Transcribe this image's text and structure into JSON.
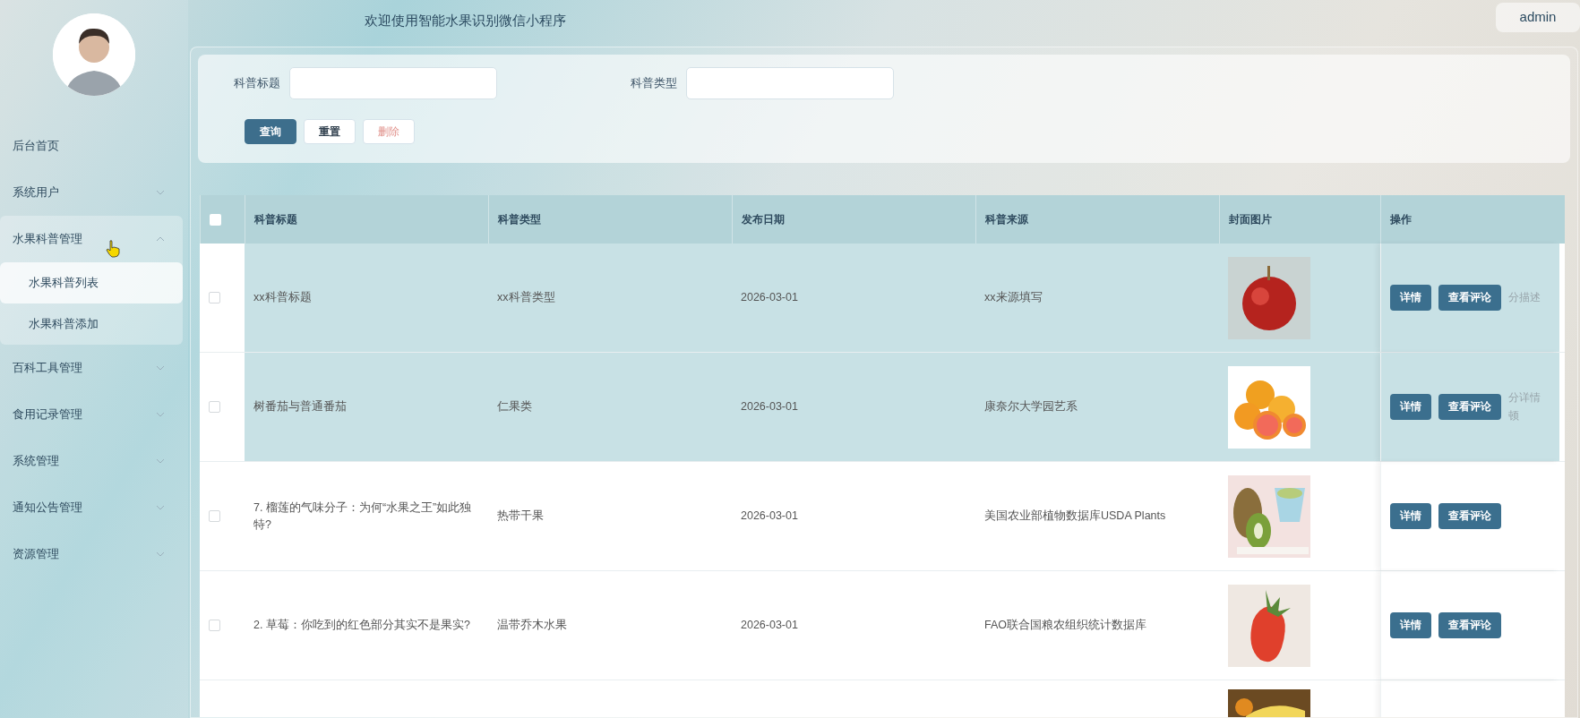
{
  "header": {
    "title": "欢迎使用智能水果识别微信小程序",
    "user": "admin"
  },
  "sidebar": {
    "items": [
      {
        "label": "后台首页"
      },
      {
        "label": "系统用户",
        "expanded": false
      },
      {
        "label": "水果科普管理",
        "expanded": true,
        "children": [
          {
            "label": "水果科普列表",
            "selected": true
          },
          {
            "label": "水果科普添加",
            "selected": false
          }
        ]
      },
      {
        "label": "百科工具管理",
        "expanded": false
      },
      {
        "label": "食用记录管理",
        "expanded": false
      },
      {
        "label": "系统管理",
        "expanded": false
      },
      {
        "label": "通知公告管理",
        "expanded": false
      },
      {
        "label": "资源管理",
        "expanded": false
      }
    ]
  },
  "search": {
    "fields": [
      {
        "label": "科普标题"
      },
      {
        "label": "科普类型"
      }
    ],
    "buttons": [
      {
        "label": "查询",
        "kind": "primary"
      },
      {
        "label": "重置",
        "kind": "plain"
      },
      {
        "label": "删除",
        "kind": "danger"
      }
    ]
  },
  "table": {
    "select_all": {
      "checked": false
    },
    "columns": [
      "科普标题",
      "科普类型",
      "发布日期",
      "科普来源",
      "封面图片",
      "操作"
    ],
    "rows": [
      {
        "checked": false,
        "highlighted": true,
        "title": "xx科普标题",
        "type": "xx科普类型",
        "date": "2026-03-01",
        "source": "xx来源填写",
        "cover": {
          "kind": "picture"
        },
        "actions": [
          "详情",
          "查看评论"
        ],
        "overflow_lines": [
          "分描述"
        ]
      },
      {
        "checked": false,
        "highlighted": true,
        "title": "树番茄与普通番茄",
        "type": "仁果类",
        "date": "2026-03-01",
        "source": "康奈尔大学园艺系",
        "cover": {
          "kind": "picture"
        },
        "actions": [
          "详情",
          "查看评论"
        ],
        "overflow_lines": [
          "分详情",
          "顿"
        ]
      },
      {
        "checked": false,
        "highlighted": false,
        "title": "7. 榴莲的气味分子：为何“水果之王”如此独特?",
        "type": "热带干果",
        "date": "2026-03-01",
        "source": "美国农业部植物数据库USDA Plants",
        "cover": {
          "kind": "picture"
        },
        "actions": [
          "详情",
          "查看评论"
        ]
      },
      {
        "checked": false,
        "highlighted": false,
        "title": "2. 草莓：你吃到的红色部分其实不是果实?",
        "type": "温带乔木水果",
        "date": "2026-03-01",
        "source": "FAO联合国粮农组织统计数据库",
        "cover": {
          "kind": "picture"
        },
        "actions": [
          "详情",
          "查看评论"
        ]
      },
      {
        "highlighted": false,
        "cover": {
          "kind": "picture"
        }
      }
    ]
  }
}
